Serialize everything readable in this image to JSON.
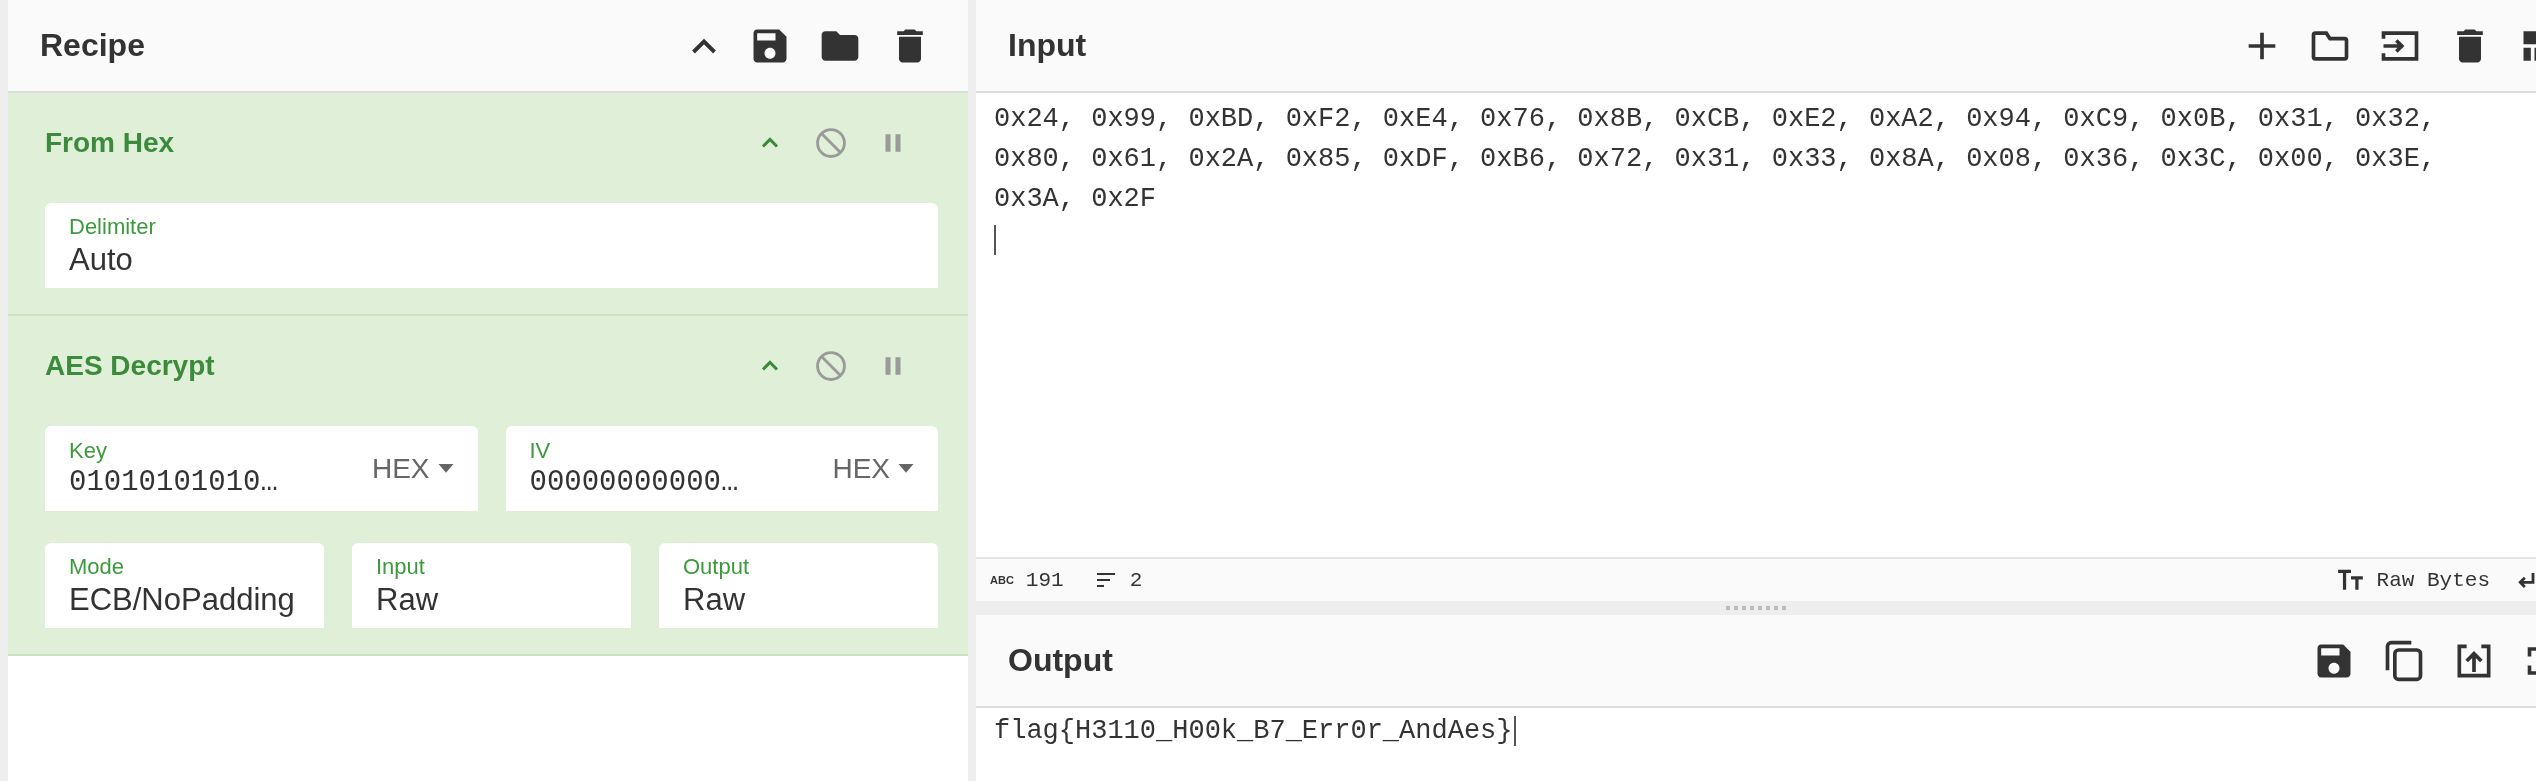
{
  "recipe": {
    "title": "Recipe"
  },
  "operations": [
    {
      "name": "From Hex",
      "fields": [
        {
          "kind": "wide",
          "label": "Delimiter",
          "value": "Auto"
        }
      ]
    },
    {
      "name": "AES Decrypt",
      "fields": [
        {
          "kind": "toggle",
          "label": "Key",
          "value": "01010101010…",
          "option": "HEX"
        },
        {
          "kind": "toggle",
          "label": "IV",
          "value": "00000000000…",
          "option": "HEX"
        },
        {
          "kind": "text",
          "label": "Mode",
          "value": "ECB/NoPadding"
        },
        {
          "kind": "text",
          "label": "Input",
          "value": "Raw"
        },
        {
          "kind": "text",
          "label": "Output",
          "value": "Raw"
        }
      ]
    }
  ],
  "input": {
    "title": "Input",
    "text": "0x24, 0x99, 0xBD, 0xF2, 0xE4, 0x76, 0x8B, 0xCB, 0xE2, 0xA2, 0x94, 0xC9, 0x0B, 0x31, 0x32, 0x80, 0x61, 0x2A, 0x85, 0xDF, 0xB6, 0x72, 0x31, 0x33, 0x8A, 0x08, 0x36, 0x3C, 0x00, 0x3E, 0x3A, 0x2F"
  },
  "status_bar": {
    "length_label": "ABC",
    "length": "191",
    "lines": "2",
    "format": "Raw Bytes"
  },
  "output": {
    "title": "Output",
    "text": "flag{H3110_H00k_B7_Err0r_AndAes}"
  }
}
